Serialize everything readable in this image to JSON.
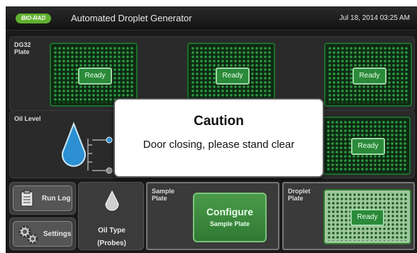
{
  "header": {
    "logo": "BIO-RAD",
    "title": "Automated Droplet Generator",
    "datetime": "Jul 18, 2014 03:25 AM"
  },
  "dg32": {
    "label_line1": "DG32",
    "label_line2": "Plate",
    "slots": [
      {
        "status": "Ready"
      },
      {
        "status": "Ready"
      },
      {
        "status": "Ready"
      }
    ]
  },
  "oil_level": {
    "label": "Oil Level"
  },
  "plate4": {
    "status": "Ready"
  },
  "buttons": {
    "run_log": "Run Log",
    "settings": "Settings",
    "oil_type": "Oil Type",
    "oil_type_value": "(Probes)"
  },
  "sample_plate": {
    "label_line1": "Sample",
    "label_line2": "Plate",
    "configure_title": "Configure",
    "configure_sub": "Sample Plate"
  },
  "droplet_plate": {
    "label_line1": "Droplet",
    "label_line2": "Plate",
    "status": "Ready"
  },
  "modal": {
    "title": "Caution",
    "message": "Door closing, please stand clear"
  }
}
